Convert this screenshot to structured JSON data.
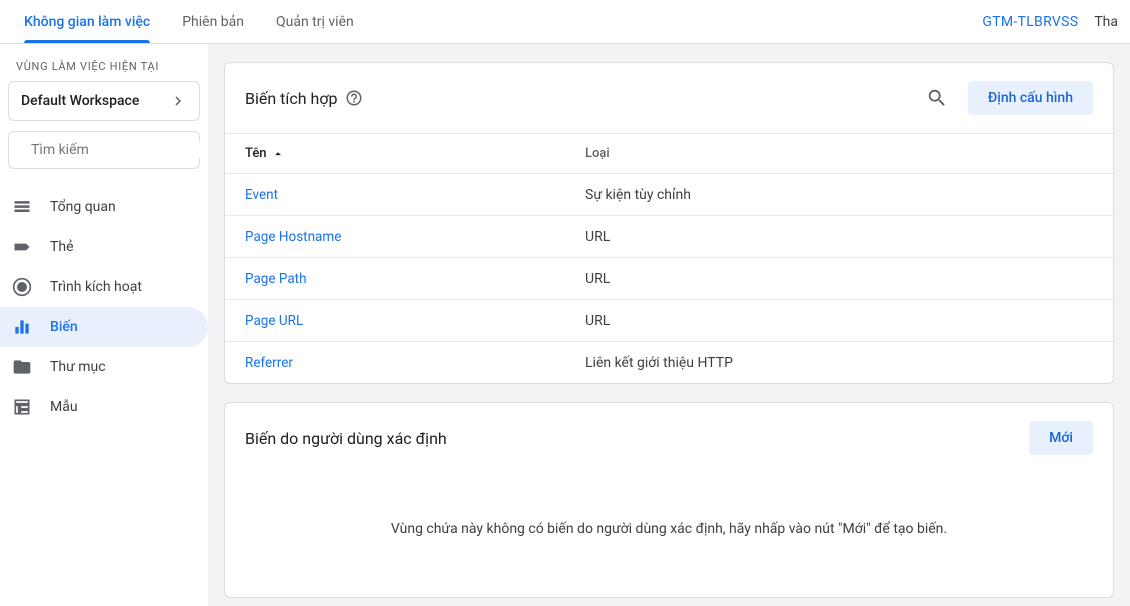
{
  "top": {
    "tabs": {
      "workspace": "Không gian làm việc",
      "versions": "Phiên bản",
      "admin": "Quản trị viên"
    },
    "container_id": "GTM-TLBRVSS",
    "extra": "Tha"
  },
  "sidebar": {
    "current_ws_label": "VÙNG LÀM VIỆC HIỆN TẠI",
    "workspace_name": "Default Workspace",
    "search_placeholder": "Tìm kiếm",
    "items": {
      "overview": "Tổng quan",
      "tags": "Thẻ",
      "triggers": "Trình kích hoạt",
      "variables": "Biến",
      "folders": "Thư mục",
      "templates": "Mẫu"
    }
  },
  "builtin": {
    "title": "Biến tích hợp",
    "configure_btn": "Định cấu hình",
    "cols": {
      "name": "Tên",
      "type": "Loại"
    },
    "rows": [
      {
        "name": "Event",
        "type": "Sự kiện tùy chỉnh"
      },
      {
        "name": "Page Hostname",
        "type": "URL"
      },
      {
        "name": "Page Path",
        "type": "URL"
      },
      {
        "name": "Page URL",
        "type": "URL"
      },
      {
        "name": "Referrer",
        "type": "Liên kết giới thiệu HTTP"
      }
    ]
  },
  "userdef": {
    "title": "Biến do người dùng xác định",
    "new_btn": "Mới",
    "empty": "Vùng chứa này không có biến do người dùng xác định, hãy nhấp vào nút \"Mới\" để tạo biến."
  }
}
